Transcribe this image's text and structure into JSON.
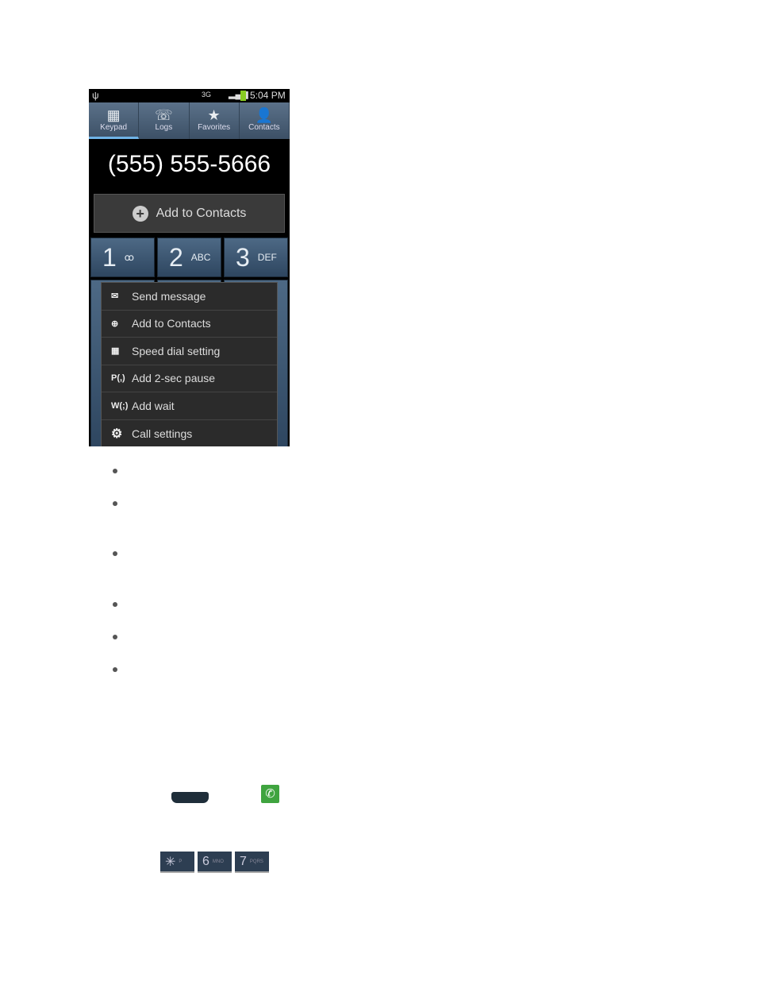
{
  "status_bar": {
    "time": "5:04 PM",
    "network": "3G"
  },
  "tabs": [
    {
      "label": "Keypad",
      "icon": "keypad-icon",
      "active": true
    },
    {
      "label": "Logs",
      "icon": "phone-logs-icon"
    },
    {
      "label": "Favorites",
      "icon": "star-icon"
    },
    {
      "label": "Contacts",
      "icon": "person-icon"
    }
  ],
  "dialed_number": "(555) 555-5666",
  "add_to_contacts": "Add to Contacts",
  "keys": [
    {
      "digit": "1",
      "letters": "ꝏ"
    },
    {
      "digit": "2",
      "letters": "ABC"
    },
    {
      "digit": "3",
      "letters": "DEF"
    }
  ],
  "menu": [
    {
      "label": "Send message",
      "icon": "send-message-icon",
      "glyph": "✉"
    },
    {
      "label": "Add to Contacts",
      "icon": "add-contact-icon",
      "glyph": "⊕"
    },
    {
      "label": "Speed dial setting",
      "icon": "speed-dial-icon",
      "glyph": "▦"
    },
    {
      "label": "Add 2-sec pause",
      "icon": "pause-icon",
      "glyph": "P(,)"
    },
    {
      "label": "Add wait",
      "icon": "wait-icon",
      "glyph": "W(;)"
    },
    {
      "label": "Call settings",
      "icon": "gear-icon",
      "glyph": "⚙"
    }
  ],
  "small_keys": [
    {
      "digit": "✳",
      "letters": "P"
    },
    {
      "digit": "6",
      "letters": "MNO"
    },
    {
      "digit": "7",
      "letters": "PQRS"
    }
  ],
  "colors": {
    "tab_active": "#6fb3e6",
    "key": "#3d5773",
    "call_green": "#3fa43f"
  }
}
